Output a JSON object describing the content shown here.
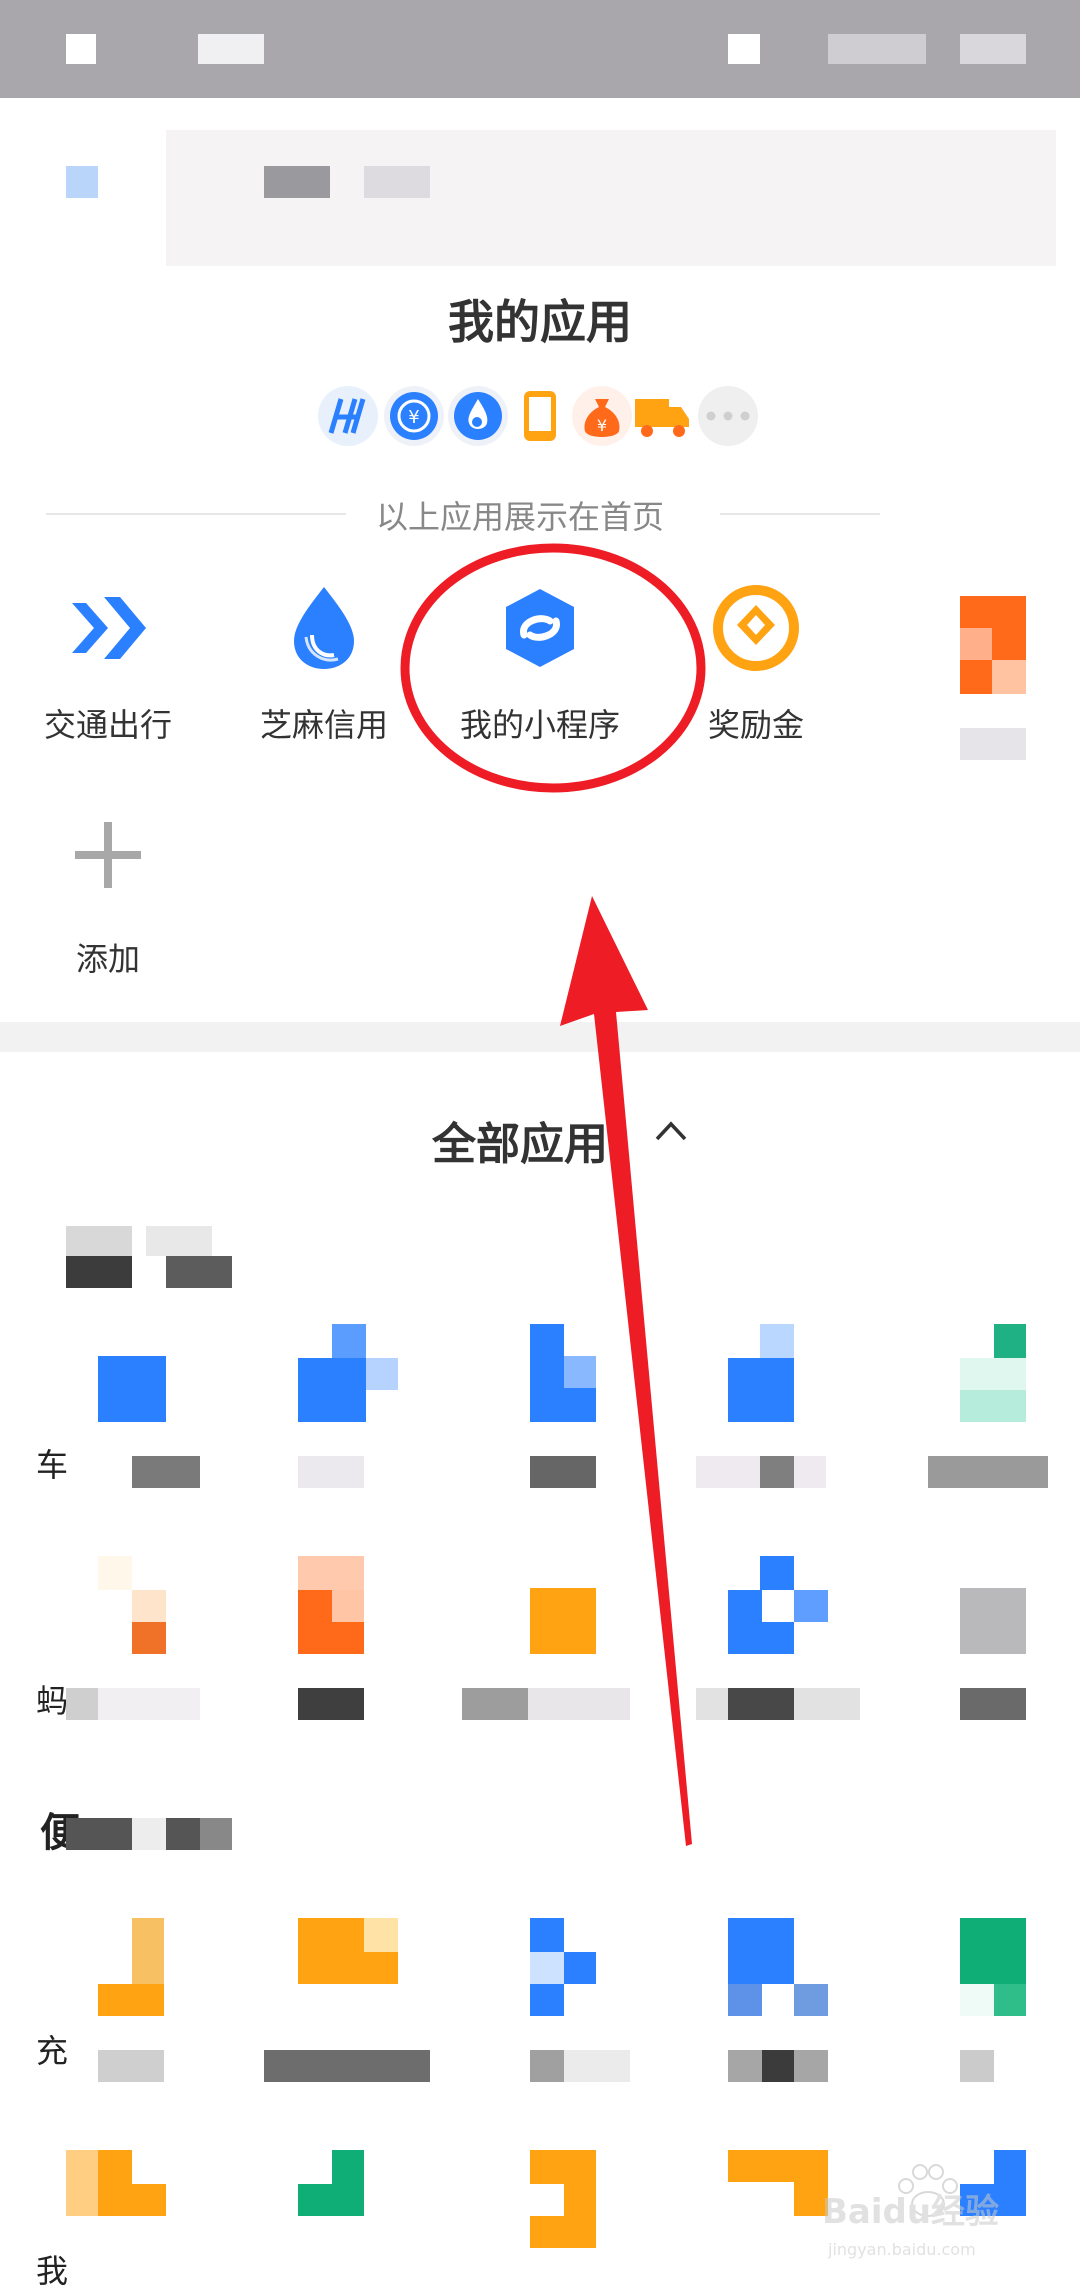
{
  "my_apps": {
    "title": "我的应用",
    "homepage_hint": "以上应用展示在首页",
    "pinned_icons": [
      "highway-icon",
      "coin-exchange-icon",
      "sesame-drop-icon",
      "phone-icon",
      "money-bag-icon",
      "truck-icon",
      "more-dots-icon"
    ],
    "items": [
      {
        "label": "交通出行",
        "icon": "double-chevron-icon"
      },
      {
        "label": "芝麻信用",
        "icon": "sesame-drop-icon"
      },
      {
        "label": "我的小程序",
        "icon": "mini-program-icon"
      },
      {
        "label": "奖励金",
        "icon": "reward-coin-icon"
      }
    ],
    "add_label": "添加"
  },
  "all_apps": {
    "title": "全部应用",
    "collapse_icon": "chevron-up-icon",
    "row_labels": [
      "车",
      "蚂",
      "充",
      "我"
    ],
    "section_second_initial": "便"
  },
  "watermark": {
    "brand": "Baidu经验",
    "url": "jingyan.baidu.com"
  },
  "colors": {
    "accent_blue": "#2b80ff",
    "orange": "#ffa312",
    "green": "#0fae77",
    "annotation_red": "#ee1c25"
  }
}
